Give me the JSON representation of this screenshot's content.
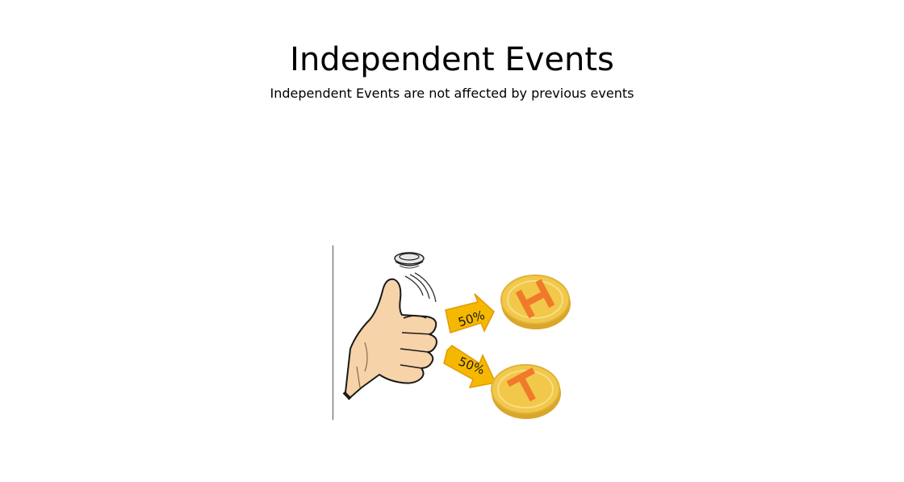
{
  "title": "Independent Events",
  "subtitle": "Independent Events are not affected by previous events",
  "illustration": {
    "arrows": [
      {
        "label": "50%",
        "outcome": "H"
      },
      {
        "label": "50%",
        "outcome": "T"
      }
    ],
    "colors": {
      "coin_gold": "#f2c84b",
      "coin_edge": "#d9a62a",
      "letter": "#f07a2a",
      "arrow": "#f5b800",
      "skin": "#f6d3a8"
    }
  }
}
